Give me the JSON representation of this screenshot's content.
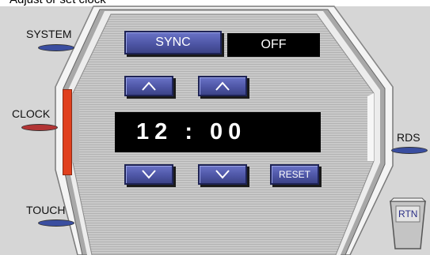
{
  "colors": {
    "button_face": "#5a63b8",
    "display_bg": "#000000",
    "clock_bar": "#e0401e",
    "clock_pill": "#b23434",
    "pill_blue": "#3a4ea0",
    "frame": "#d8d8d8"
  },
  "top_partial_text": "Adjust or set clock",
  "left_labels": {
    "system": "SYSTEM",
    "clock": "CLOCK",
    "touch": "TOUCH"
  },
  "right_labels": {
    "rds": "RDS",
    "rtn": "RTN"
  },
  "sync": {
    "label": "SYNC",
    "status": "OFF"
  },
  "clock": {
    "time": "12 : 00"
  },
  "buttons": {
    "hour_up_icon": "chevron-up-icon",
    "minute_up_icon": "chevron-up-icon",
    "hour_down_icon": "chevron-down-icon",
    "minute_down_icon": "chevron-down-icon",
    "reset": "RESET"
  }
}
